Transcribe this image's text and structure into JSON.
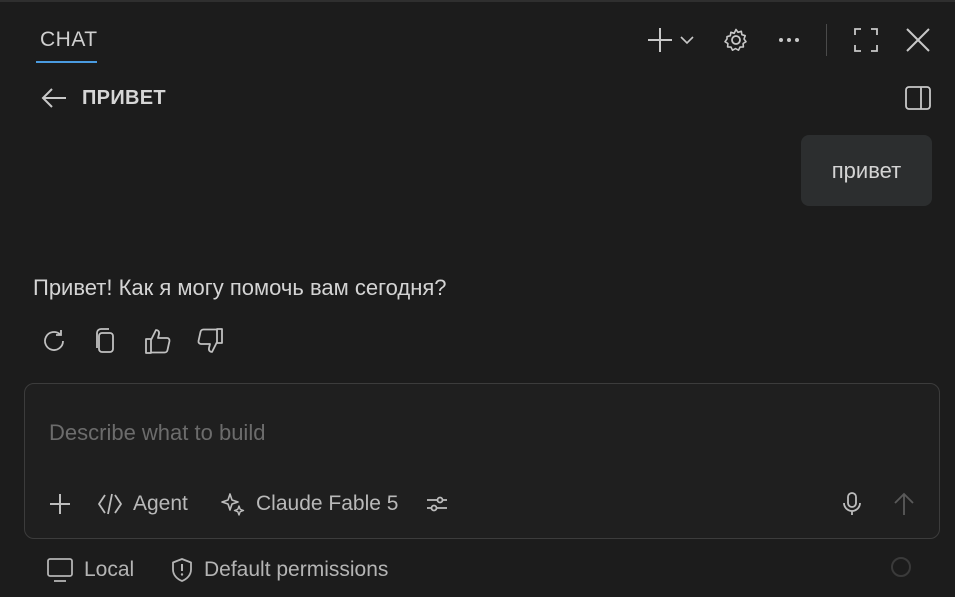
{
  "header": {
    "tab_label": "CHAT",
    "icons": [
      "plus-icon",
      "chevron-down-icon",
      "gear-icon",
      "more-icon",
      "maximize-icon",
      "close-icon"
    ]
  },
  "conversation": {
    "title": "ПРИВЕТ"
  },
  "messages": {
    "user_text": "привет",
    "assistant_text": "Привет! Как я могу помочь вам сегодня?"
  },
  "input": {
    "placeholder": "Describe what to build",
    "value": ""
  },
  "toolbar": {
    "mode_label": "Agent",
    "model_label": "Claude Fable 5"
  },
  "footer": {
    "location_label": "Local",
    "permissions_label": "Default permissions"
  },
  "colors": {
    "background": "#1c1c1c",
    "accent": "#4a9be0",
    "bubble": "#2c2e2f"
  }
}
